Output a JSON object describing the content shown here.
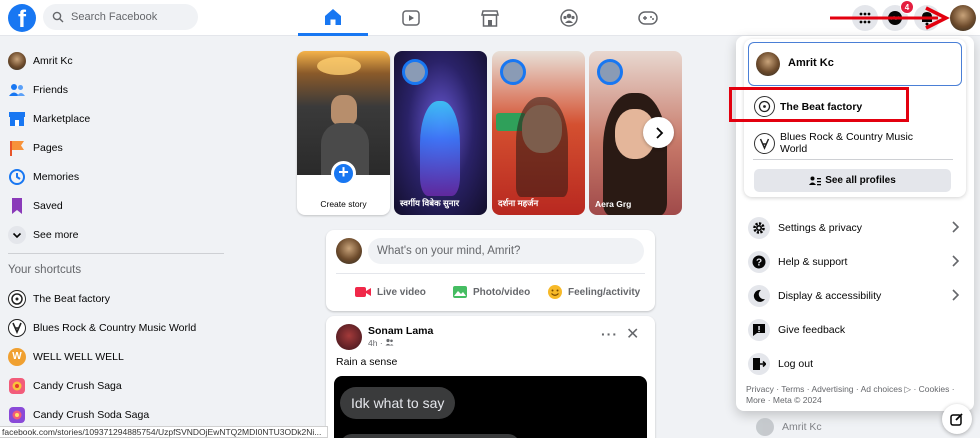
{
  "brand": {
    "logo_letter": "f",
    "accent": "#1877f2"
  },
  "search": {
    "placeholder": "Search Facebook"
  },
  "nav": {
    "tabs": [
      {
        "name": "home",
        "active": true
      },
      {
        "name": "watch"
      },
      {
        "name": "marketplace"
      },
      {
        "name": "groups"
      },
      {
        "name": "gaming"
      }
    ],
    "notifications_badge": "4"
  },
  "sidebar": {
    "items": [
      {
        "label": "Amrit Kc",
        "icon": "avatar"
      },
      {
        "label": "Friends",
        "icon": "friends-icon"
      },
      {
        "label": "Marketplace",
        "icon": "marketplace-icon"
      },
      {
        "label": "Pages",
        "icon": "pages-flag-icon"
      },
      {
        "label": "Memories",
        "icon": "memories-clock-icon"
      },
      {
        "label": "Saved",
        "icon": "saved-bookmark-icon"
      },
      {
        "label": "See more",
        "icon": "chevron-down-icon"
      }
    ],
    "shortcuts_heading": "Your shortcuts",
    "shortcuts": [
      {
        "label": "The Beat factory"
      },
      {
        "label": "Blues Rock & Country Music World"
      },
      {
        "label": "WELL WELL WELL",
        "letter": "W"
      },
      {
        "label": "Candy Crush Saga"
      },
      {
        "label": "Candy Crush Soda Saga"
      }
    ]
  },
  "stories": {
    "create_label": "Create story",
    "items": [
      {
        "name": "स्वर्गीय विबेक सुनार"
      },
      {
        "name": "दर्शना महर्जन"
      },
      {
        "name": "Aera Grg"
      }
    ]
  },
  "composer": {
    "placeholder": "What's on your mind, Amrit?",
    "live_label": "Live video",
    "photo_label": "Photo/video",
    "feeling_label": "Feeling/activity"
  },
  "post": {
    "author": "Sonam Lama",
    "time": "4h",
    "text": "Rain a sense",
    "bubble_text": "Idk what to say"
  },
  "account_menu": {
    "current_profile": "Amrit Kc",
    "profiles": [
      {
        "label": "The Beat factory"
      },
      {
        "label": "Blues Rock & Country Music World"
      }
    ],
    "see_all_label": "See all profiles",
    "items": [
      {
        "label": "Settings & privacy",
        "icon": "gear-icon",
        "chevron": true
      },
      {
        "label": "Help & support",
        "icon": "question-icon",
        "chevron": true
      },
      {
        "label": "Display & accessibility",
        "icon": "moon-icon",
        "chevron": true
      },
      {
        "label": "Give feedback",
        "icon": "feedback-icon",
        "chevron": false
      },
      {
        "label": "Log out",
        "icon": "logout-icon",
        "chevron": false
      }
    ],
    "footer": "Privacy · Terms · Advertising · Ad choices ▷ · Cookies · More · Meta © 2024"
  },
  "contacts_ghost_name": "Amrit Kc",
  "status_url": "facebook.com/stories/109371294885754/UzpfSVNDOjEwNTQ2MDI0NTU3ODk2Ni..."
}
